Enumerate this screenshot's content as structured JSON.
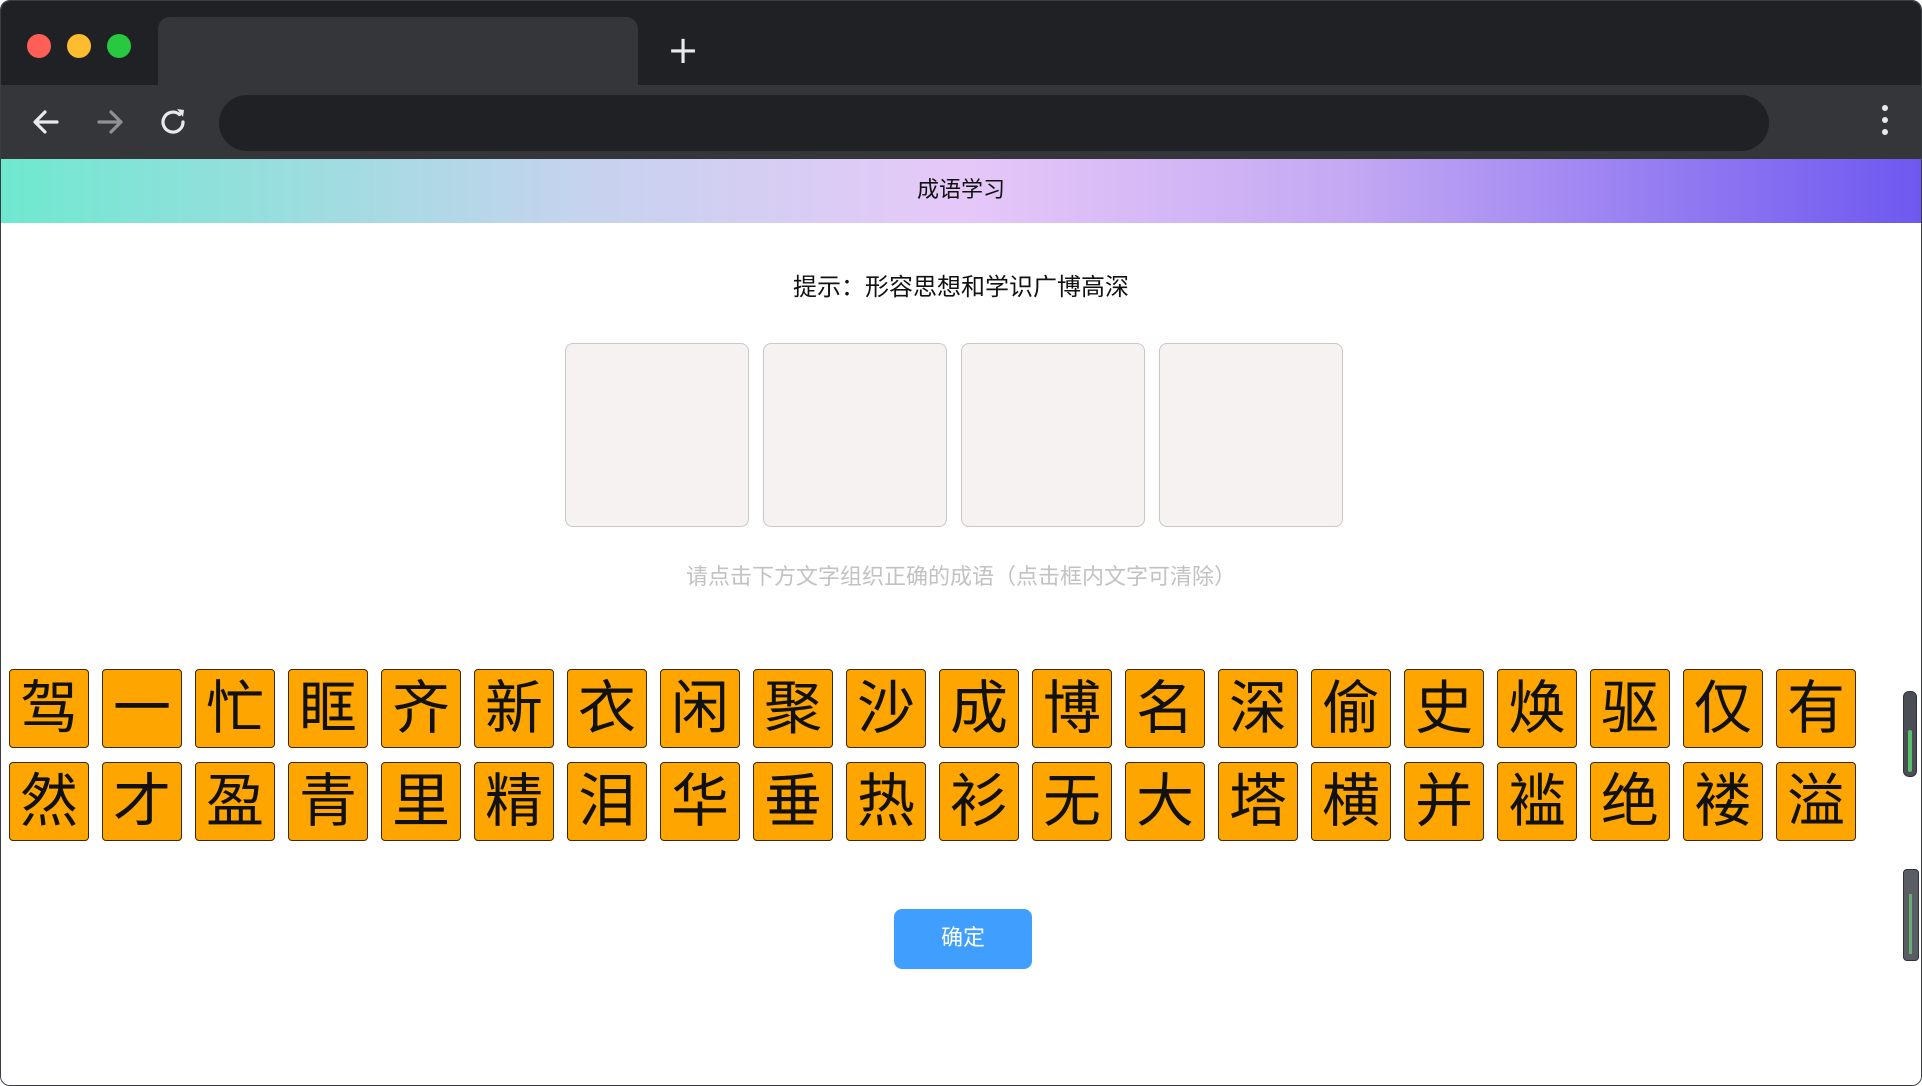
{
  "browser": {
    "new_tab_glyph": "+",
    "icons": [
      "back-arrow-icon",
      "forward-arrow-icon",
      "reload-icon",
      "more-vert-icon"
    ],
    "address_value": ""
  },
  "page": {
    "header_title": "成语学习",
    "hint_label": "提示：",
    "hint_text": "形容思想和学识广博高深",
    "slots": [
      "",
      "",
      "",
      ""
    ],
    "instruction": "请点击下方文字组织正确的成语（点击框内文字可清除）",
    "characters_row1": [
      "驾",
      "一",
      "忙",
      "眶",
      "齐",
      "新",
      "衣",
      "闲",
      "聚",
      "沙",
      "成",
      "博",
      "名",
      "深",
      "偷",
      "史",
      "焕",
      "驱",
      "仅",
      "有"
    ],
    "characters_row2": [
      "然",
      "才",
      "盈",
      "青",
      "里",
      "精",
      "泪",
      "华",
      "垂",
      "热",
      "衫",
      "无",
      "大",
      "塔",
      "横",
      "并",
      "褴",
      "绝",
      "褛",
      "溢"
    ],
    "confirm_label": "确定"
  },
  "colors": {
    "char_tile": "#ffa500",
    "confirm_button": "#409eff",
    "slot_bg": "#f6f2f2",
    "instruction_text": "#c2c2c2"
  }
}
